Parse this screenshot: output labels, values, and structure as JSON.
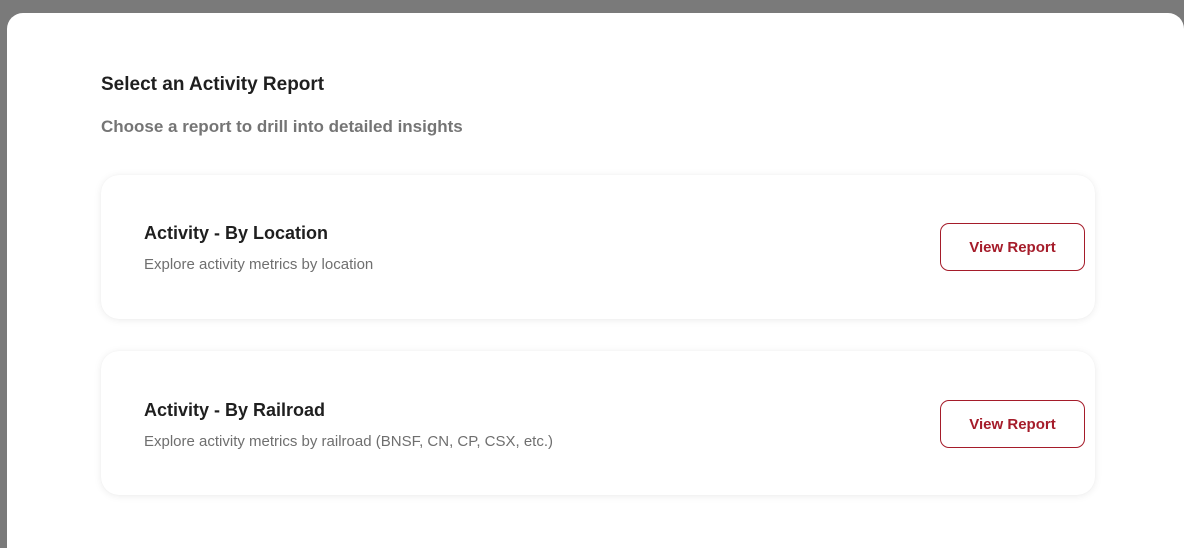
{
  "panel": {
    "title": "Select an Activity Report",
    "subtitle": "Choose a report to drill into detailed insights"
  },
  "reports": [
    {
      "title": "Activity - By Location",
      "description": "Explore activity metrics by location",
      "button_label": "View Report"
    },
    {
      "title": "Activity - By Railroad",
      "description": "Explore activity metrics by railroad (BNSF, CN, CP, CSX, etc.)",
      "button_label": "View Report"
    }
  ],
  "colors": {
    "accent": "#a51c2a",
    "backdrop": "#7a7a7a",
    "title_text": "#1f1f1f",
    "muted_text": "#757575"
  }
}
